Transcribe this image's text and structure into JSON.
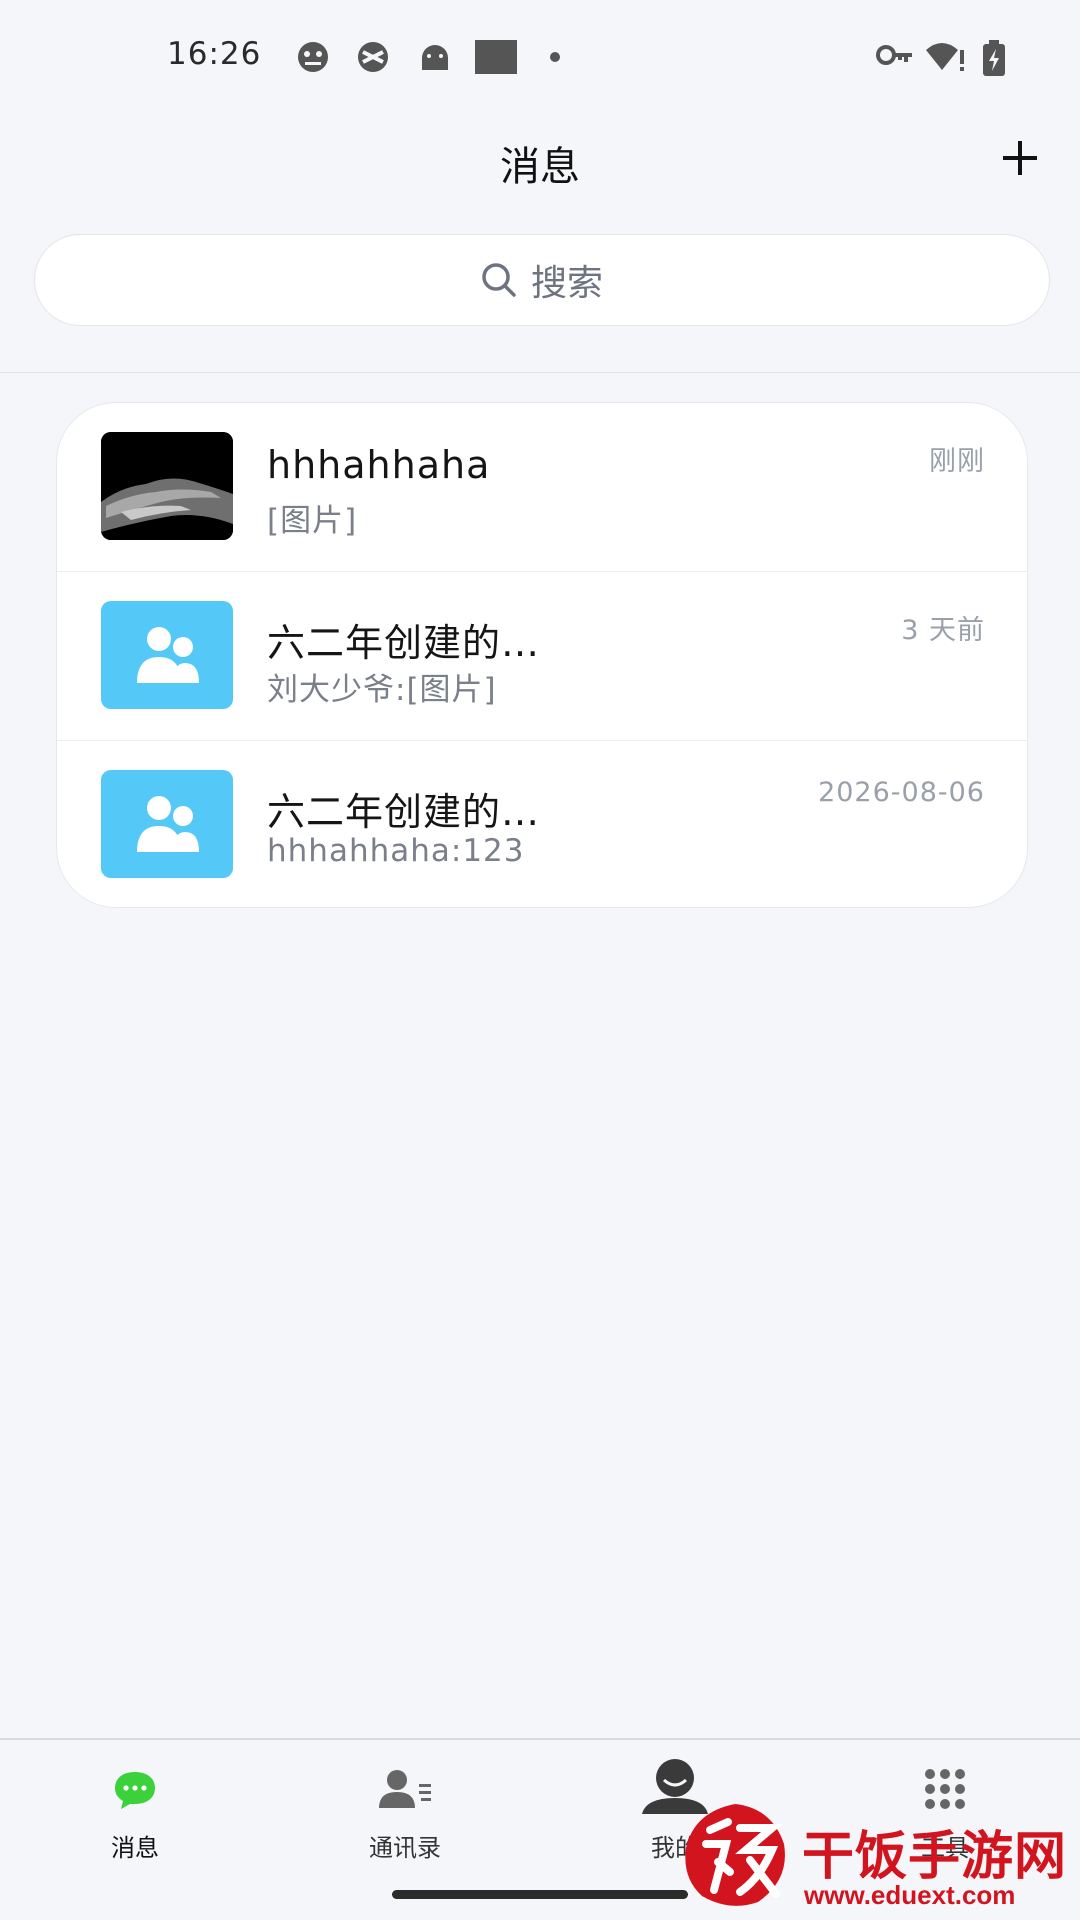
{
  "status_bar": {
    "time": "16:26",
    "left_icons": [
      "notification-face-icon",
      "vpn-shield-icon",
      "android-icon",
      "square-icon",
      "dot-icon"
    ],
    "right_icons": [
      "key-icon",
      "wifi-alert-icon",
      "battery-charging-icon"
    ]
  },
  "header": {
    "title": "消息",
    "add_icon": "plus-icon"
  },
  "search": {
    "placeholder": "搜索"
  },
  "chats": [
    {
      "name": "hhhahhaha",
      "preview": "[图片]",
      "time": "刚刚",
      "avatar": "photo"
    },
    {
      "name": "六二年创建的…",
      "preview": "刘大少爷:[图片]",
      "time": "3 天前",
      "avatar": "group-icon"
    },
    {
      "name": "六二年创建的…",
      "preview": "hhhahhaha:123",
      "time": "2026-08-06",
      "avatar": "group-icon"
    }
  ],
  "nav": {
    "items": [
      {
        "label": "消息",
        "icon": "chat-bubble-icon",
        "active": true
      },
      {
        "label": "通讯录",
        "icon": "contacts-icon",
        "active": false
      },
      {
        "label": "我的",
        "icon": "profile-icon",
        "active": false
      },
      {
        "label": "工具",
        "icon": "grid-icon",
        "active": false
      }
    ]
  },
  "watermark": {
    "text": "干饭手游网",
    "url": "www.eduext.com"
  },
  "colors": {
    "background": "#f5f6fa",
    "active_tab": "#3ad13a",
    "group_avatar": "#54c8f7",
    "watermark": "#d2141e"
  }
}
